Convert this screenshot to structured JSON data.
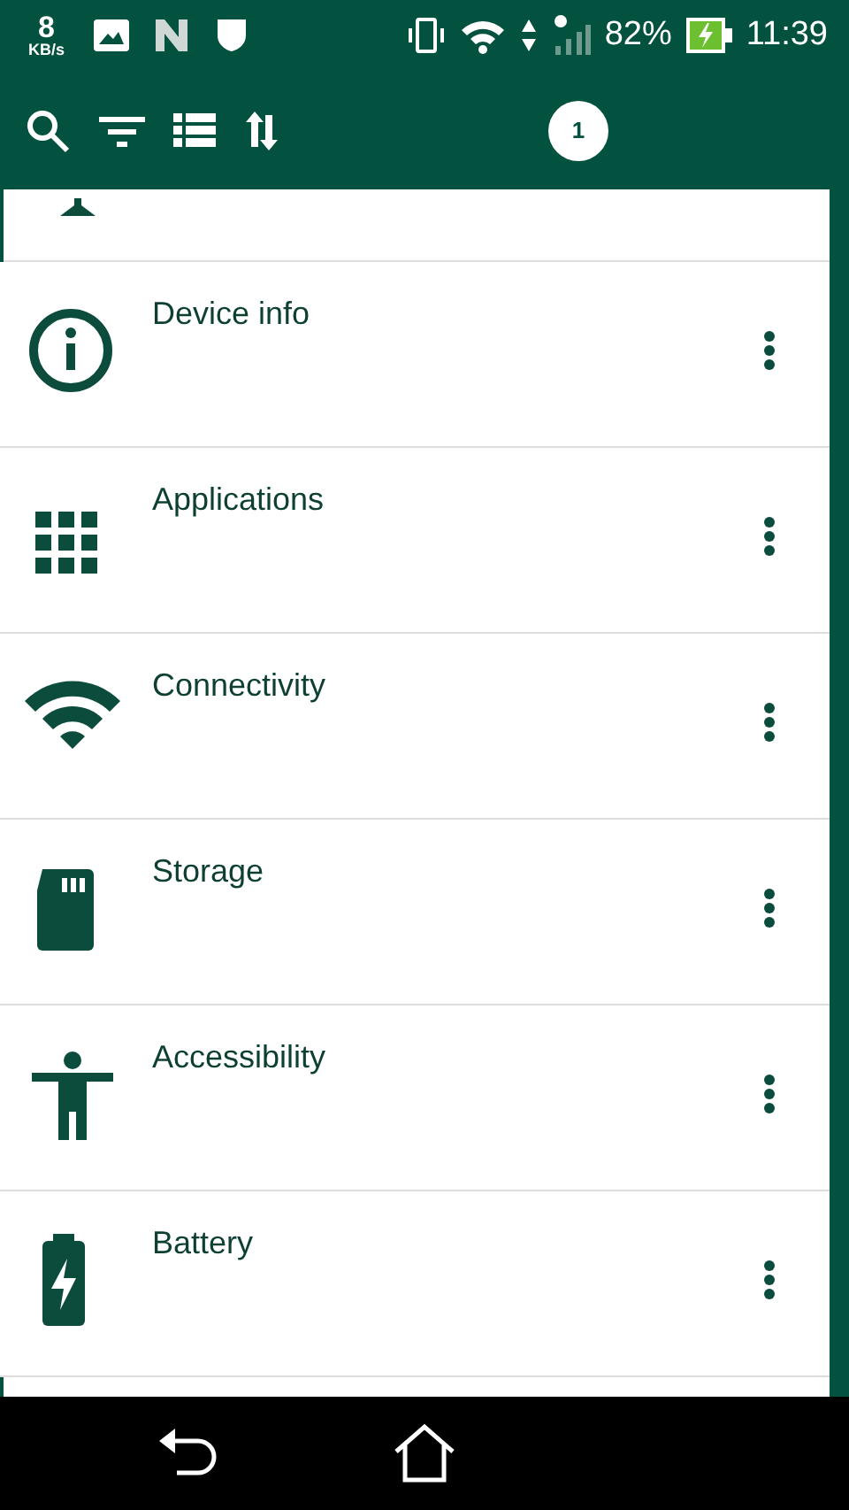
{
  "status_bar": {
    "speed": "8",
    "speed_unit": "KB/s",
    "battery": "82%",
    "time": "11:39"
  },
  "toolbar": {
    "badge": "1"
  },
  "items": [
    {
      "label": "Device info",
      "kind": "info"
    },
    {
      "label": "Applications",
      "kind": "apps"
    },
    {
      "label": "Connectivity",
      "kind": "wifi"
    },
    {
      "label": "Storage",
      "kind": "storage"
    },
    {
      "label": "Accessibility",
      "kind": "accessibility"
    },
    {
      "label": "Battery",
      "kind": "battery"
    }
  ]
}
